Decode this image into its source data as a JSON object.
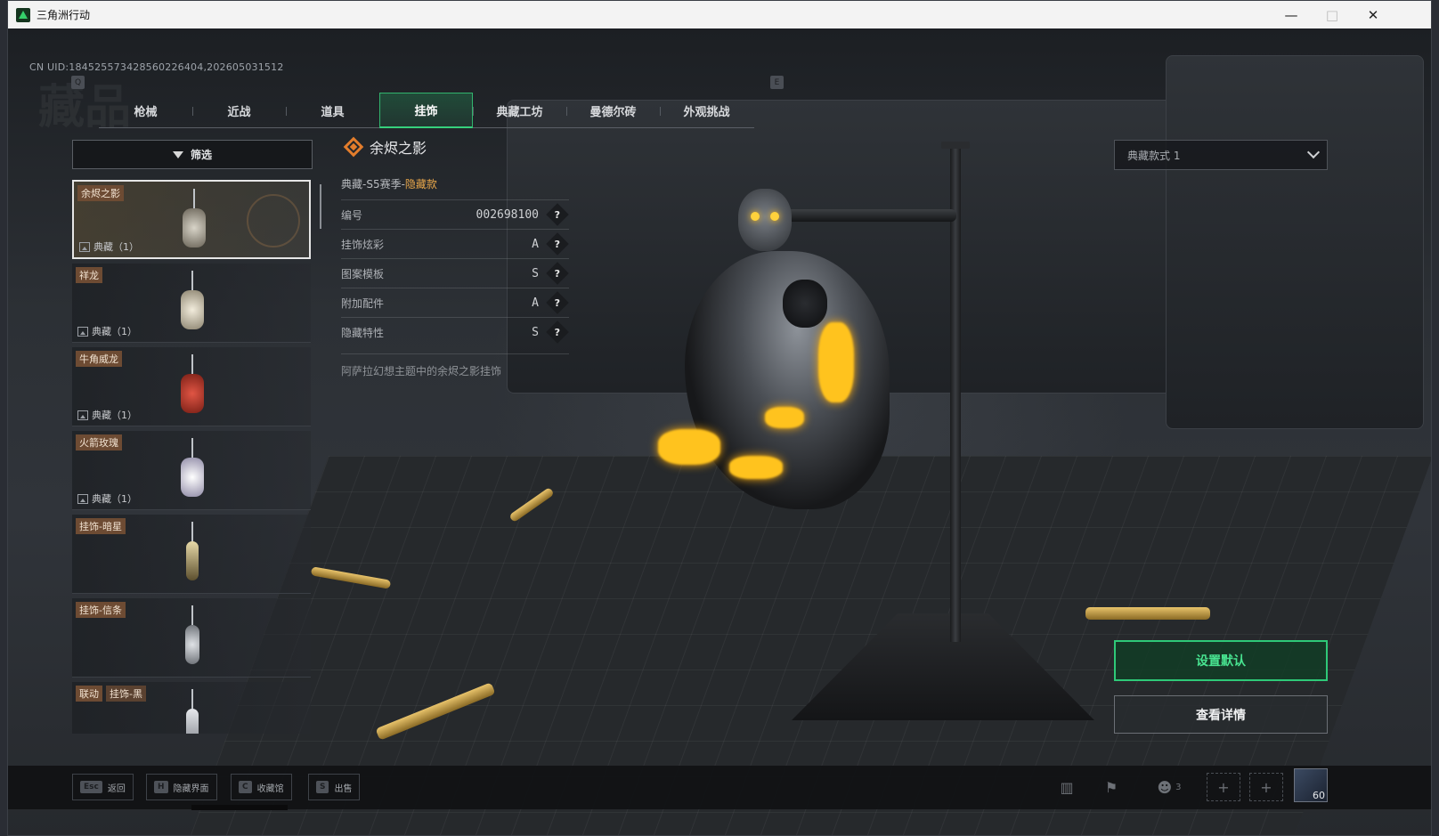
{
  "window": {
    "title": "三角洲行动",
    "controls": {
      "minimize": "—",
      "maximize": "□",
      "close": "✕"
    }
  },
  "uid": "CN UID:1845255734285602264​04,202605031512",
  "uid_clean": "CN UID:184525573428560226404,202605031512",
  "watermark": "藏品",
  "tabs": {
    "prev_key": "Q",
    "next_key": "E",
    "items": [
      {
        "label": "枪械"
      },
      {
        "label": "近战"
      },
      {
        "label": "道具"
      },
      {
        "label": "挂饰",
        "active": true
      },
      {
        "label": "典藏工坊"
      },
      {
        "label": "曼德尔砖"
      },
      {
        "label": "外观挑战"
      }
    ]
  },
  "filter": {
    "label": "筛选"
  },
  "list": [
    {
      "name": "余烬之影",
      "tag": "典藏（1）",
      "selected": true,
      "color": "#c9c9c9"
    },
    {
      "name": "祥龙",
      "tag": "典藏（1）",
      "color": "#e0d9c6"
    },
    {
      "name": "牛角威龙",
      "tag": "典藏（1）",
      "color": "#c63b2c"
    },
    {
      "name": "火箭玫瑰",
      "tag": "典藏（1）",
      "color": "#e9e4ef"
    },
    {
      "name": "挂饰-暗星",
      "tag": "",
      "color": "#d8cba0"
    },
    {
      "name": "挂饰-信条",
      "tag": "",
      "color": "#b7bbc0"
    },
    {
      "name": "联动",
      "name2": "挂饰-黑",
      "tag": "",
      "color": "#d0d3d8"
    }
  ],
  "detail": {
    "title": "余烬之影",
    "subtitle_prefix": "典藏-S5赛季-",
    "subtitle_highlight": "隐藏款",
    "attributes": [
      {
        "label": "编号",
        "value": "002698100"
      },
      {
        "label": "挂饰炫彩",
        "value": "A"
      },
      {
        "label": "图案模板",
        "value": "S"
      },
      {
        "label": "附加配件",
        "value": "A"
      },
      {
        "label": "隐藏特性",
        "value": "S"
      }
    ],
    "help": "?",
    "description": "阿萨拉幻想主题中的余烬之影挂饰"
  },
  "style_select": {
    "value": "典藏款式 1"
  },
  "buttons": {
    "set_default": "设置默认",
    "view_detail": "查看详情"
  },
  "hotkeys": [
    {
      "key": "Esc",
      "label": "返回"
    },
    {
      "key": "H",
      "label": "隐藏界面"
    },
    {
      "key": "C",
      "label": "收藏馆"
    },
    {
      "key": "S",
      "label": "出售"
    }
  ],
  "bottom_right": {
    "party_count": "3",
    "level": "60"
  },
  "colors": {
    "accent_green": "#2ec978",
    "rarity_gold": "#e8a64a",
    "tag_brown": "#6d4b33"
  }
}
